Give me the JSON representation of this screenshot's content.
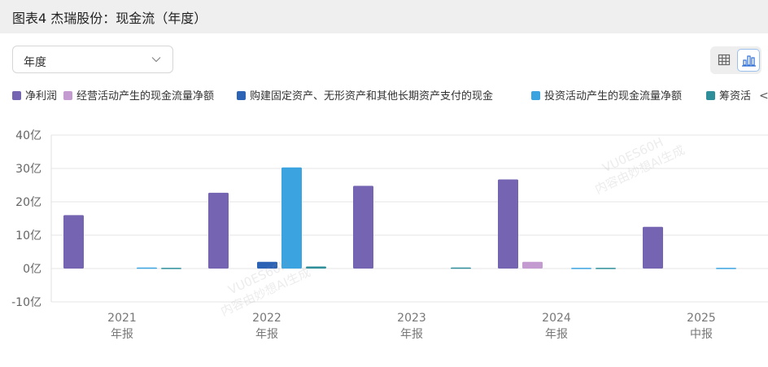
{
  "header": {
    "title": "图表4 杰瑞股份：现金流（年度）"
  },
  "period_select": {
    "value": "年度"
  },
  "view_toggle": {
    "table_icon": "table-icon",
    "chart_icon": "bar-chart-icon",
    "active": "chart"
  },
  "legend": {
    "prev_label": "<"
  },
  "watermarks": [
    "VU0ES60H",
    "内容由妙想AI生成"
  ],
  "chart_data": {
    "type": "bar",
    "title": "",
    "xlabel": "",
    "ylabel": "",
    "ylim": [
      -10,
      40
    ],
    "yticks": [
      -10,
      0,
      10,
      20,
      30,
      40
    ],
    "ytick_labels": [
      "-10亿",
      "0亿",
      "10亿",
      "20亿",
      "30亿",
      "40亿"
    ],
    "grid": true,
    "legend_position": "top",
    "categories": [
      "2021\n年报",
      "2022\n年报",
      "2023\n年报",
      "2024\n年报",
      "2025\n中报"
    ],
    "category_lines": [
      [
        "2021",
        "年报"
      ],
      [
        "2022",
        "年报"
      ],
      [
        "2023",
        "年报"
      ],
      [
        "2024",
        "年报"
      ],
      [
        "2025",
        "中报"
      ]
    ],
    "series": [
      {
        "name": "净利润",
        "color": "#7464b1",
        "values": [
          16,
          22.7,
          24.8,
          26.7,
          12.5
        ]
      },
      {
        "name": "经营活动产生的现金流量净额",
        "color": "#c49bd1",
        "values": [
          0,
          0,
          0,
          2,
          0
        ]
      },
      {
        "name": "购建固定资产、无形资产和其他长期资产支付的现金",
        "color": "#2d63b5",
        "values": [
          0,
          2,
          0,
          0,
          0
        ]
      },
      {
        "name": "投资活动产生的现金流量净额",
        "color": "#3aa3e0",
        "values": [
          0.3,
          30.3,
          0,
          0.2,
          0.2
        ]
      },
      {
        "name": "筹资活动产生的现金流量净额",
        "legend_label": "筹资活",
        "color": "#2e8e99",
        "values": [
          0.2,
          0.6,
          0.3,
          0.2,
          0
        ]
      }
    ]
  }
}
